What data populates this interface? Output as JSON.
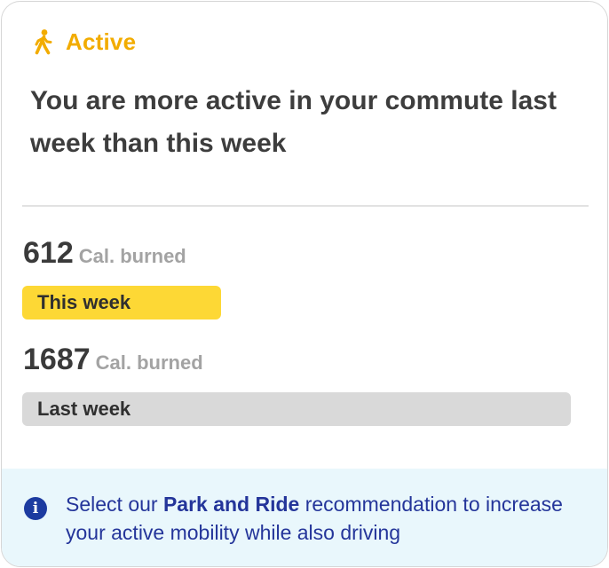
{
  "header": {
    "icon": "walking-person-icon",
    "label": "Active",
    "accent_color": "#f2ac00"
  },
  "headline": "You are more active in your commute last week than this week",
  "metrics": [
    {
      "value": "612",
      "unit": "Cal. burned",
      "bar_label": "This week",
      "bar_color": "#fdd835",
      "fraction_of_max": 0.363
    },
    {
      "value": "1687",
      "unit": "Cal. burned",
      "bar_label": "Last week",
      "bar_color": "#d9d9d9",
      "fraction_of_max": 1.0
    }
  ],
  "info": {
    "icon": "info-icon",
    "text_before": "Select our ",
    "link_text": "Park and Ride",
    "text_after": " recommendation to increase your active mobility while also driving",
    "background_color": "#e9f7fc",
    "text_color": "#24359a"
  }
}
